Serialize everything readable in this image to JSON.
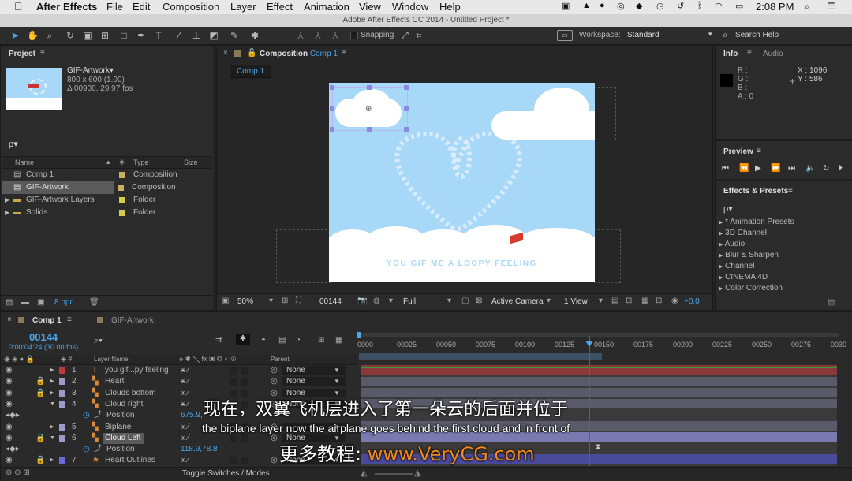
{
  "menubar": {
    "apple": "",
    "app": "After Effects",
    "items": [
      "File",
      "Edit",
      "Composition",
      "Layer",
      "Effect",
      "Animation",
      "View",
      "Window",
      "Help"
    ],
    "status_icons": [
      "screen-icon",
      "drive-icon",
      "bell-icon",
      "cc-icon",
      "dropbox-icon",
      "clock-icon",
      "history-icon",
      "bluetooth-icon",
      "wifi-icon",
      "battery-icon"
    ],
    "time": "2:08 PM"
  },
  "titlebar": {
    "title": "Adobe After Effects CC 2014 - Untitled Project *"
  },
  "toolbar": {
    "snapping": "Snapping",
    "workspace_label": "Workspace:",
    "workspace_value": "Standard",
    "search": "Search Help"
  },
  "project": {
    "tab": "Project",
    "asset_name": "GIF-Artwork▾",
    "asset_size": "800 x 600 (1.00)",
    "asset_duration": "Δ 00900, 29.97 fps",
    "search_placeholder": "ρ▾",
    "headers": {
      "name": "Name",
      "type": "Type",
      "size": "Size"
    },
    "items": [
      {
        "name": "Comp 1",
        "type": "Composition",
        "color": "#c8b060"
      },
      {
        "name": "GIF-Artwork",
        "type": "Composition",
        "color": "#c8b060"
      },
      {
        "name": "GIF-Artwork Layers",
        "type": "Folder",
        "color": "#d6cc4a"
      },
      {
        "name": "Solids",
        "type": "Folder",
        "color": "#d6cc4a"
      }
    ],
    "bpc": "8 bpc"
  },
  "composition": {
    "tab_prefix": "Composition",
    "tab_name": "Comp 1",
    "subtab": "Comp 1",
    "zoom": "50%",
    "timecode": "00144",
    "resolution": "Full",
    "camera": "Active Camera",
    "view": "1 View",
    "exposure": "+0.0",
    "overlay_text": "YOU GIF ME A LOOPY FEELING"
  },
  "info": {
    "tab": "Info",
    "tab2": "Audio",
    "r": "R :",
    "g": "G :",
    "b": "B :",
    "a": "A : 0",
    "x": "X : 1096",
    "y": "Y : 586"
  },
  "preview": {
    "tab": "Preview"
  },
  "effects": {
    "tab": "Effects & Presets",
    "search": "ρ▾",
    "items": [
      "* Animation Presets",
      "3D Channel",
      "Audio",
      "Blur & Sharpen",
      "Channel",
      "CINEMA 4D",
      "Color Correction"
    ]
  },
  "timeline": {
    "tab1": "Comp 1",
    "tab2": "GIF-Artwork",
    "timecode": "00144",
    "timecode_sub": "0:00:04:24 (30.00 fps)",
    "header_layer": "Layer Name",
    "header_parent": "Parent",
    "toggle": "Toggle Switches / Modes",
    "ruler": [
      "0000",
      "00025",
      "00050",
      "00075",
      "00100",
      "00125",
      "00150",
      "00175",
      "00200",
      "00225",
      "00250",
      "00275",
      "0030"
    ],
    "layers": [
      {
        "num": "1",
        "name": "you gif...py feeling",
        "color": "#c23a3a",
        "parent": "None",
        "kind": "T"
      },
      {
        "num": "2",
        "name": "Heart",
        "color": "#9c9ccc",
        "parent": "None",
        "kind": "*"
      },
      {
        "num": "3",
        "name": "Clouds bottom",
        "color": "#9c9ccc",
        "parent": "None",
        "kind": "*"
      },
      {
        "num": "4",
        "name": "Cloud right",
        "color": "#9c9ccc",
        "parent": "None",
        "kind": "*"
      },
      {
        "prop": "Position",
        "value": "675.9,"
      },
      {
        "num": "5",
        "name": "Biplane",
        "color": "#9c9ccc",
        "parent": "",
        "kind": "*"
      },
      {
        "num": "6",
        "name": "Cloud Left",
        "color": "#9c9ccc",
        "parent": "None",
        "kind": "*"
      },
      {
        "prop": "Position",
        "value": "118.9,78.8"
      },
      {
        "num": "7",
        "name": "Heart Outlines",
        "color": "#6a6adc",
        "parent": "None",
        "kind": "★"
      }
    ]
  },
  "subtitles": {
    "zh": "现在，双翼飞机层进入了第一朵云的后面并位于",
    "en": "the biplane layer now the airplane goes behind the first cloud and in front of",
    "zh2": "更多教程:",
    "url": "www.VeryCG.com"
  },
  "colors": {
    "accent": "#4aa6e8",
    "sky": "#a8d8f8",
    "timeline_cursor": "#d23030"
  }
}
